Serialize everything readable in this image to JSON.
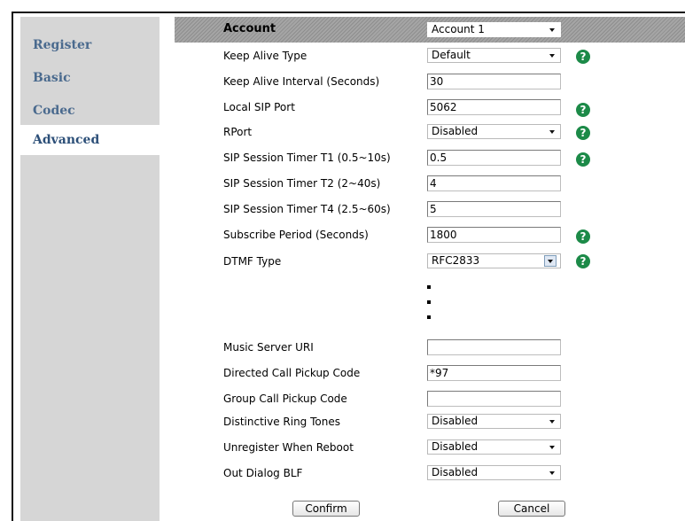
{
  "sidebar": {
    "items": [
      {
        "label": "Register"
      },
      {
        "label": "Basic"
      },
      {
        "label": "Codec"
      },
      {
        "label": "Advanced",
        "active": true
      }
    ]
  },
  "header": {
    "label": "Account",
    "account_value": "Account 1"
  },
  "fields": {
    "keep_alive_type": {
      "label": "Keep Alive Type",
      "value": "Default"
    },
    "keep_alive_interval": {
      "label": "Keep Alive Interval (Seconds)",
      "value": "30"
    },
    "local_sip_port": {
      "label": "Local SIP Port",
      "value": "5062"
    },
    "rport": {
      "label": "RPort",
      "value": "Disabled"
    },
    "t1": {
      "label": "SIP Session Timer T1 (0.5~10s)",
      "value": "0.5"
    },
    "t2": {
      "label": "SIP Session Timer T2 (2~40s)",
      "value": "4"
    },
    "t4": {
      "label": "SIP Session Timer T4 (2.5~60s)",
      "value": "5"
    },
    "subscribe_period": {
      "label": "Subscribe Period (Seconds)",
      "value": "1800"
    },
    "dtmf_type": {
      "label": "DTMF Type",
      "value": "RFC2833"
    },
    "music_server_uri": {
      "label": "Music Server URI",
      "value": ""
    },
    "directed_pickup": {
      "label": "Directed Call Pickup Code",
      "value": "*97"
    },
    "group_pickup": {
      "label": "Group Call Pickup Code",
      "value": ""
    },
    "distinctive_ring": {
      "label": "Distinctive Ring Tones",
      "value": "Disabled"
    },
    "unregister_reboot": {
      "label": "Unregister When Reboot",
      "value": "Disabled"
    },
    "out_dialog_blf": {
      "label": "Out Dialog BLF",
      "value": "Disabled"
    }
  },
  "help_glyph": "?",
  "buttons": {
    "confirm": "Confirm",
    "cancel": "Cancel"
  },
  "colors": {
    "sidebar_bg": "#d6d6d6",
    "sidebar_text": "#4a6a8e",
    "header_bg": "#9a9a9a",
    "help_icon": "#1c8a48"
  }
}
